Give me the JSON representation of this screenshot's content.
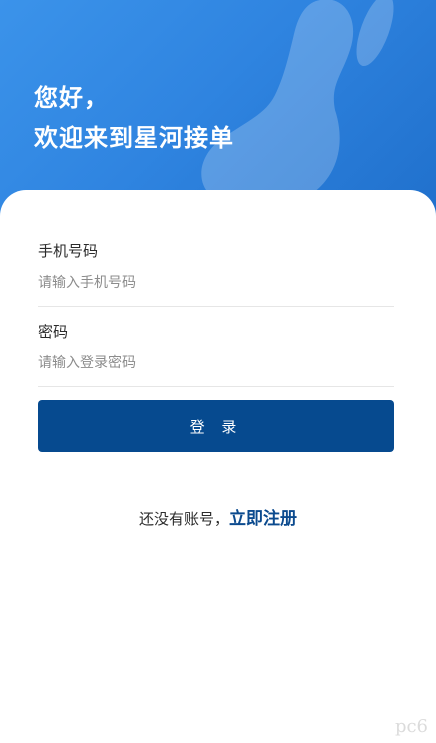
{
  "hero": {
    "greeting_line1": "您好，",
    "greeting_line2": "欢迎来到星河接单"
  },
  "form": {
    "phone": {
      "label": "手机号码",
      "placeholder": "请输入手机号码",
      "value": ""
    },
    "password": {
      "label": "密码",
      "placeholder": "请输入登录密码",
      "value": ""
    },
    "login_button": "登 录"
  },
  "register": {
    "prompt": "还没有账号，",
    "link": "立即注册"
  },
  "watermark": {
    "text": "pc6"
  },
  "colors": {
    "hero_gradient_start": "#3b93ea",
    "hero_gradient_end": "#1f6fcb",
    "primary_button": "#064a8f",
    "link": "#0b4a8e"
  }
}
